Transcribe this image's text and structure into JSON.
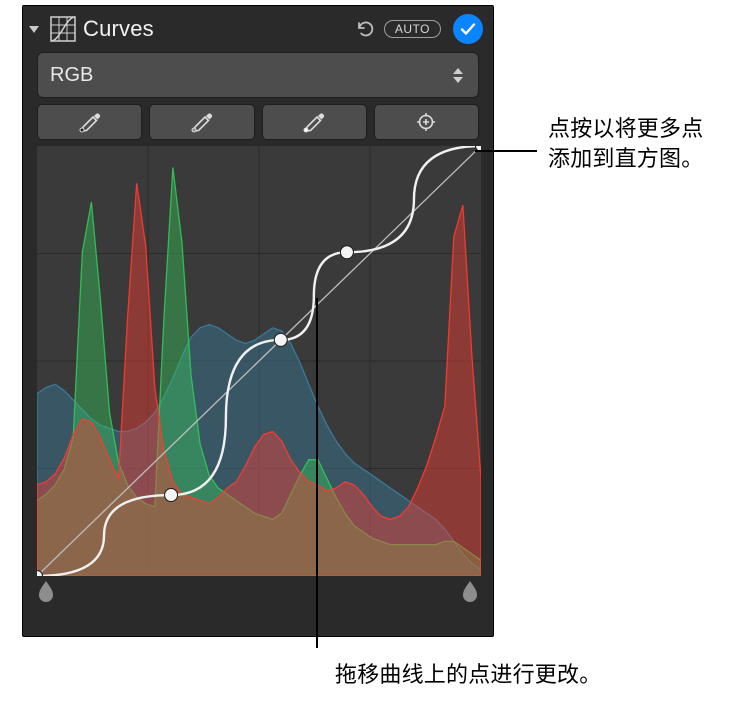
{
  "header": {
    "title": "Curves",
    "auto_label": "AUTO"
  },
  "channel": {
    "selected": "RGB"
  },
  "tools": {
    "black_point": "eyedropper-black",
    "gray_point": "eyedropper-gray",
    "white_point": "eyedropper-white",
    "add_point": "add-point"
  },
  "callouts": {
    "add_point_hint": "点按以将更多点\n添加到直方图。",
    "drag_point_hint": "拖移曲线上的点进行更改。"
  },
  "chart_data": {
    "type": "area",
    "title": "",
    "xlabel": "",
    "ylabel": "",
    "xlim": [
      0,
      255
    ],
    "ylim": [
      0,
      255
    ],
    "grid": {
      "x_divisions": 4,
      "y_divisions": 4
    },
    "diagonal_reference": true,
    "curve_points": [
      {
        "x": 0,
        "y": 0
      },
      {
        "x": 77,
        "y": 48
      },
      {
        "x": 140,
        "y": 140
      },
      {
        "x": 178,
        "y": 192
      },
      {
        "x": 255,
        "y": 255
      }
    ],
    "series": [
      {
        "name": "Red",
        "color": "#ff3b30",
        "values": [
          58,
          60,
          65,
          75,
          90,
          100,
          98,
          88,
          74,
          62,
          165,
          250,
          210,
          120,
          80,
          60,
          52,
          50,
          48,
          46,
          50,
          56,
          60,
          70,
          82,
          90,
          92,
          86,
          74,
          66,
          60,
          58,
          54,
          56,
          60,
          58,
          52,
          44,
          38,
          36,
          38,
          44,
          56,
          70,
          88,
          108,
          216,
          236,
          140,
          62
        ]
      },
      {
        "name": "Green",
        "color": "#34c759",
        "values": [
          48,
          52,
          58,
          68,
          88,
          206,
          238,
          176,
          104,
          72,
          58,
          50,
          46,
          44,
          164,
          260,
          212,
          128,
          84,
          64,
          56,
          52,
          48,
          44,
          40,
          38,
          36,
          40,
          52,
          64,
          74,
          74,
          62,
          50,
          40,
          32,
          28,
          24,
          22,
          20,
          20,
          20,
          20,
          20,
          20,
          22,
          22,
          18,
          14,
          10
        ]
      },
      {
        "name": "Blue",
        "color": "#3a7ea3",
        "values": [
          116,
          120,
          122,
          118,
          112,
          106,
          100,
          96,
          94,
          92,
          92,
          94,
          98,
          104,
          114,
          126,
          140,
          152,
          158,
          160,
          158,
          154,
          150,
          148,
          150,
          154,
          158,
          156,
          148,
          136,
          122,
          108,
          96,
          86,
          78,
          72,
          68,
          64,
          60,
          56,
          52,
          48,
          44,
          40,
          36,
          30,
          22,
          14,
          8,
          4
        ]
      }
    ]
  }
}
